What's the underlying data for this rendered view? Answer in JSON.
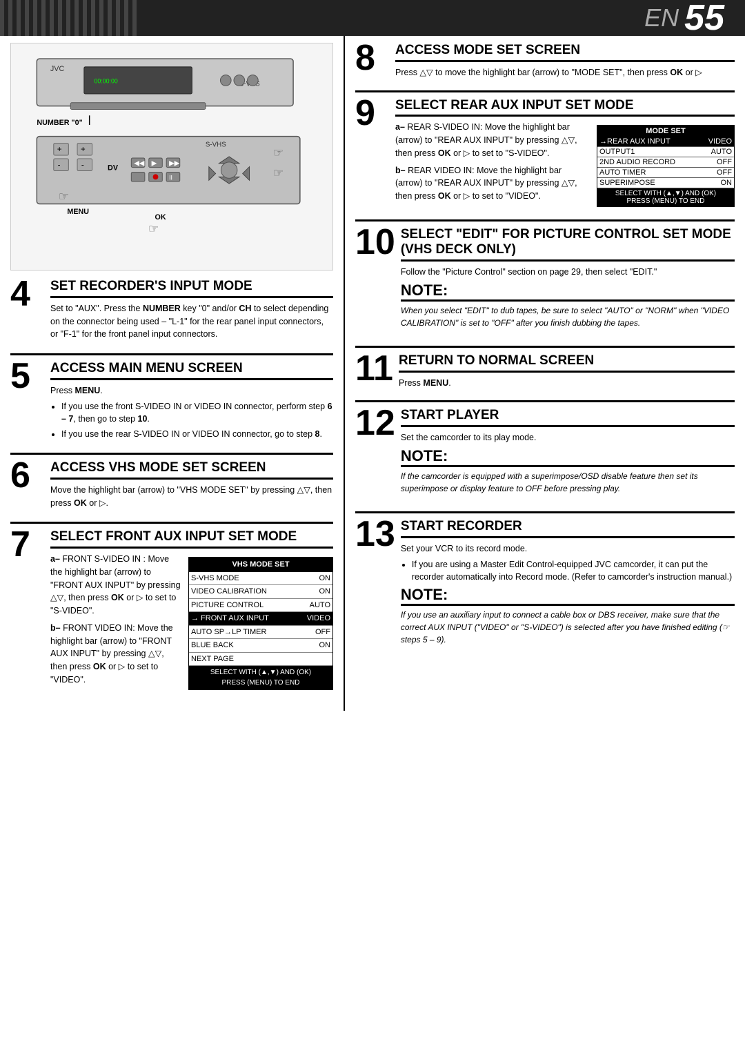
{
  "header": {
    "en_label": "EN",
    "page_number": "55"
  },
  "steps": {
    "step4": {
      "number": "4",
      "title": "Set Recorder's Input Mode",
      "body": "Set to \"AUX\". Press the NUMBER key \"0\" and/or CH to select depending on the connector being used – \"L-1\" for the rear panel input connectors, or \"F-1\" for the front panel input connectors.",
      "bold_words": [
        "NUMBER"
      ]
    },
    "step5": {
      "number": "5",
      "title": "Access Main Menu Screen",
      "press": "Press MENU.",
      "bullets": [
        "If you use the front S-VIDEO IN or VIDEO IN connector, perform step 6 – 7, then go to step 10.",
        "If you use the rear S-VIDEO IN or VIDEO IN connector, go to step 8."
      ]
    },
    "step6": {
      "number": "6",
      "title": "Access VHS Mode Set Screen",
      "body": "Move the highlight bar (arrow) to \"VHS MODE SET\" by pressing △▽, then press OK or ▷."
    },
    "step7": {
      "number": "7",
      "title": "Select Front Aux Input Set Mode",
      "a_label": "a–",
      "a_text": "FRONT S-VIDEO IN : Move the highlight bar (arrow) to \"FRONT AUX INPUT\" by pressing △▽, then press OK or ▷ to set to \"S-VIDEO\".",
      "b_label": "b–",
      "b_text": "FRONT VIDEO IN: Move the highlight bar (arrow) to \"FRONT AUX INPUT\" by pressing △▽, then press OK or ▷ to set to \"VIDEO\".",
      "vhs_table": {
        "header": "VHS MODE SET",
        "rows": [
          {
            "label": "S-VHS MODE",
            "value": "ON",
            "selected": false
          },
          {
            "label": "VIDEO CALIBRATION",
            "value": "ON",
            "selected": false
          },
          {
            "label": "PICTURE CONTROL",
            "value": "AUTO",
            "selected": false
          },
          {
            "label": "→ FRONT AUX INPUT",
            "value": "VIDEO",
            "selected": true
          },
          {
            "label": "AUTO SP→LP TIMER",
            "value": "OFF",
            "selected": false
          },
          {
            "label": "BLUE BACK",
            "value": "ON",
            "selected": false
          },
          {
            "label": "NEXT PAGE",
            "value": "",
            "selected": false
          }
        ],
        "footer": "SELECT WITH (▲,▼) AND (OK)\nPRESS (MENU) TO END"
      }
    },
    "step8": {
      "number": "8",
      "title": "Access Mode Set Screen",
      "body": "Press △▽ to move the highlight bar (arrow) to \"MODE SET\", then press OK or ▷"
    },
    "step9": {
      "number": "9",
      "title": "Select Rear Aux Input Set Mode",
      "a_label": "a–",
      "a_text": "REAR S-VIDEO IN: Move the highlight bar (arrow) to \"REAR AUX INPUT\" by pressing △▽, then press OK or ▷ to set to \"S-VIDEO\".",
      "b_label": "b–",
      "b_text": "REAR VIDEO IN: Move the highlight bar (arrow) to \"REAR AUX INPUT\" by pressing △▽, then press OK or ▷ to set to \"VIDEO\".",
      "mode_table": {
        "header": "MODE SET",
        "rows": [
          {
            "label": "→REAR AUX INPUT",
            "value": "VIDEO",
            "selected": true
          },
          {
            "label": "OUTPUT1",
            "value": "AUTO",
            "selected": false
          },
          {
            "label": "2ND AUDIO RECORD",
            "value": "OFF",
            "selected": false
          },
          {
            "label": "AUTO TIMER",
            "value": "OFF",
            "selected": false
          },
          {
            "label": "SUPERIMPOSE",
            "value": "ON",
            "selected": false
          }
        ],
        "footer": "SELECT WITH (▲,▼) AND (OK)\nPRESS (MENU) TO END"
      }
    },
    "step10": {
      "number": "10",
      "title": "Select \"Edit\" For Picture Control Set Mode (VHS Deck Only)",
      "body": "Follow the \"Picture Control\" section on page 29, then select \"EDIT\".",
      "note": {
        "title": "Note:",
        "body": "When you select \"EDIT\" to dub tapes, be sure to select \"AUTO\" or \"NORM\" when \"VIDEO CALIBRATION\" is set to \"OFF\" after you finish dubbing the tapes."
      }
    },
    "step11": {
      "number": "11",
      "title": "Return To Normal Screen",
      "body": "Press MENU.",
      "bold_words": [
        "MENU"
      ]
    },
    "step12": {
      "number": "12",
      "title": "Start Player",
      "body": "Set the camcorder to its play mode.",
      "note": {
        "title": "Note:",
        "body": "If the camcorder is equipped with a superimpose/OSD disable feature then set its superimpose or display feature to OFF before pressing play."
      }
    },
    "step13": {
      "number": "13",
      "title": "Start Recorder",
      "body": "Set your VCR to its record mode.",
      "bullets": [
        "If you are using a Master Edit Control-equipped JVC camcorder, it can put the recorder automatically into Record mode. (Refer to camcorder's instruction manual.)"
      ],
      "note": {
        "title": "Note:",
        "body": "If you use an auxiliary input to connect a cable box or DBS receiver, make sure that the correct AUX INPUT (\"VIDEO\" or \"S-VIDEO\") is selected after you have finished editing (☞ steps 5 – 9)."
      }
    }
  },
  "device": {
    "label_number0": "NUMBER \"0\"",
    "label_svhs_top": "S-VHS",
    "label_dv": "DV",
    "label_svhs_bottom": "S-VHS",
    "label_menu": "MENU",
    "label_jvc": "JVC"
  }
}
